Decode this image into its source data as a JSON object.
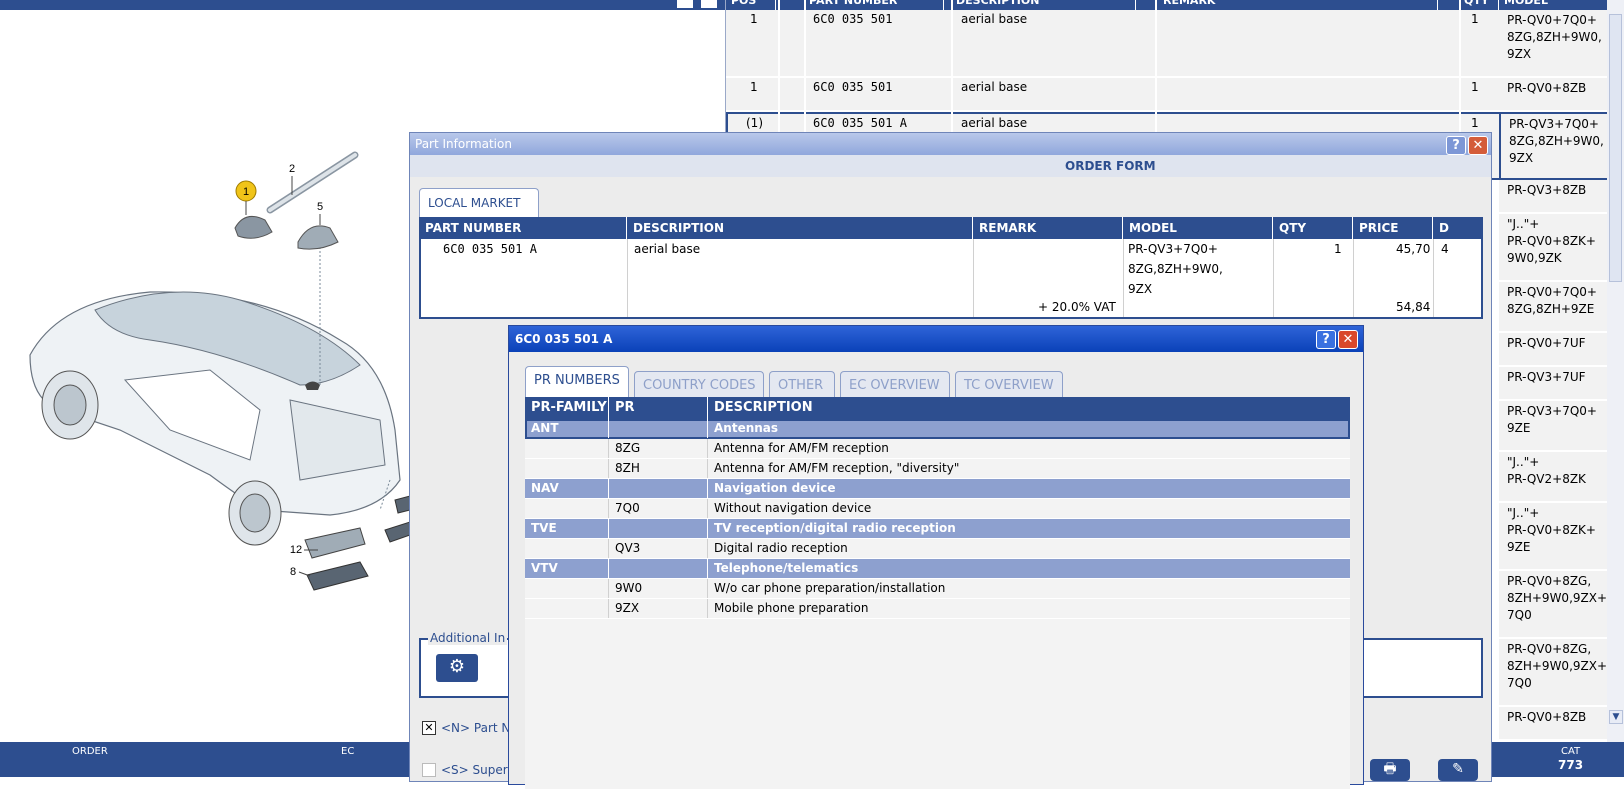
{
  "parts_table": {
    "headers": [
      "POS",
      "PART NUMBER",
      "DESCRIPTION",
      "REMARK",
      "QTY",
      "MODEL"
    ],
    "rows": [
      {
        "pos": "1",
        "part": "6C0 035 501",
        "desc": "aerial base",
        "qty": "1",
        "model": [
          "PR-QV0+7Q0+",
          "8ZG,8ZH+9W0,",
          "9ZX"
        ]
      },
      {
        "pos": "1",
        "part": "6C0 035 501",
        "desc": "aerial base",
        "qty": "1",
        "model": [
          "PR-QV0+8ZB"
        ]
      },
      {
        "pos": "(1)",
        "part": "6C0 035 501 A",
        "desc": "aerial base",
        "qty": "1",
        "model": [
          "PR-QV3+7Q0+",
          "8ZG,8ZH+9W0,",
          "9ZX"
        ]
      }
    ],
    "model_column_more": [
      [
        "PR-QV3+8ZB"
      ],
      [
        "\"J..\"+",
        "PR-QV0+8ZK+",
        "9W0,9ZK"
      ],
      [
        "PR-QV0+7Q0+",
        "8ZG,8ZH+9ZE"
      ],
      [
        "PR-QV0+7UF"
      ],
      [
        "PR-QV3+7UF"
      ],
      [
        "PR-QV3+7Q0+",
        "9ZE"
      ],
      [
        "\"J..\"+",
        "PR-QV2+8ZK"
      ],
      [
        "\"J..\"+",
        "PR-QV0+8ZK+",
        "9ZE"
      ],
      [
        "PR-QV0+8ZG,",
        "8ZH+9W0,9ZX+",
        "7Q0"
      ],
      [
        "PR-QV0+8ZG,",
        "8ZH+9W0,9ZX+",
        "7Q0"
      ],
      [
        "PR-QV0+8ZB"
      ]
    ]
  },
  "diagram": {
    "callouts": [
      "1",
      "2",
      "5",
      "12",
      "8"
    ]
  },
  "statusbar": {
    "order": "ORDER",
    "ec": "EC",
    "cat_label": "CAT",
    "cat_value": "773"
  },
  "part_info": {
    "title": "Part Information",
    "help": "?",
    "close": "✕",
    "order_form": "ORDER FORM",
    "local_market_tab": "LOCAL MARKET",
    "headers": {
      "part": "PART NUMBER",
      "desc": "DESCRIPTION",
      "remark": "REMARK",
      "model": "MODEL",
      "qty": "QTY",
      "price": "PRICE",
      "d": "D"
    },
    "row": {
      "part": "6C0 035 501 A",
      "desc": "aerial base",
      "model_l1": "PR-QV3+7Q0+",
      "model_l2": "8ZG,8ZH+9W0,",
      "model_l3": "9ZX",
      "qty": "1",
      "price": "45,70",
      "d": "4",
      "vat_label": "+ 20.0% VAT",
      "vat_price": "54,84"
    },
    "additional_label": "Additional In",
    "check_n_label": "<N> Part N",
    "check_s_label": "<S> Super"
  },
  "pr_dialog": {
    "title": "6C0 035 501 A",
    "help": "?",
    "close": "✕",
    "tabs": [
      "PR NUMBERS",
      "COUNTRY CODES",
      "OTHER",
      "EC OVERVIEW",
      "TC OVERVIEW"
    ],
    "headers": {
      "family": "PR-FAMILY",
      "numbers": "PR NUMBERS",
      "desc": "DESCRIPTION"
    },
    "rows": [
      {
        "type": "fam",
        "family": "ANT",
        "number": "",
        "desc": "Antennas"
      },
      {
        "type": "item",
        "family": "",
        "number": "8ZG",
        "desc": "Antenna for AM/FM reception"
      },
      {
        "type": "item",
        "family": "",
        "number": "8ZH",
        "desc": "Antenna for AM/FM reception, \"diversity\""
      },
      {
        "type": "fam",
        "family": "NAV",
        "number": "",
        "desc": "Navigation device"
      },
      {
        "type": "item",
        "family": "",
        "number": "7Q0",
        "desc": "Without navigation device"
      },
      {
        "type": "fam",
        "family": "TVE",
        "number": "",
        "desc": "TV reception/digital radio reception"
      },
      {
        "type": "item",
        "family": "",
        "number": "QV3",
        "desc": "Digital radio reception"
      },
      {
        "type": "fam",
        "family": "VTV",
        "number": "",
        "desc": "Telephone/telematics"
      },
      {
        "type": "item",
        "family": "",
        "number": "9W0",
        "desc": "W/o car phone preparation/installation"
      },
      {
        "type": "item",
        "family": "",
        "number": "9ZX",
        "desc": "Mobile phone preparation"
      }
    ]
  },
  "colors": {
    "navy": "#2d4e8f",
    "family_row": "#8da0cf",
    "xp_title": "#0a41b8"
  }
}
